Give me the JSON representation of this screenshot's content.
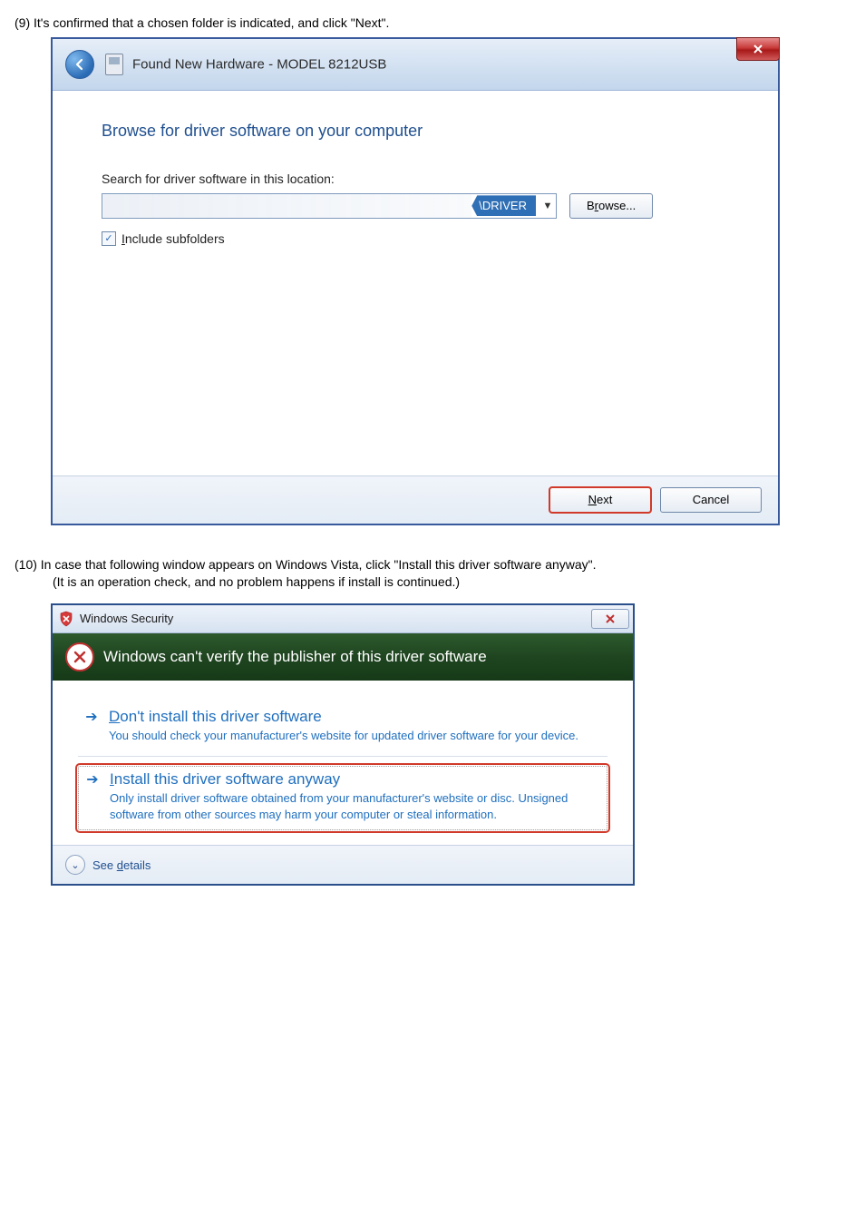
{
  "step9": {
    "text": "(9)  It's confirmed that a chosen folder is indicated, and click \"Next\"."
  },
  "win1": {
    "title": "Found New Hardware - MODEL 8212USB",
    "heading": "Browse for driver software on your computer",
    "search_label": "Search for driver software in this location:",
    "path_tag": "\\DRIVER",
    "browse_label_pre": "B",
    "browse_label_u": "r",
    "browse_label_post": "owse...",
    "include_pre": "",
    "include_u": "I",
    "include_post": "nclude subfolders",
    "next_u": "N",
    "next_post": "ext",
    "cancel": "Cancel"
  },
  "step10": {
    "text": "(10)  In case that following window appears on Windows Vista, click \"Install this driver software anyway\".",
    "sub": "(It is an operation check, and no problem happens if install is continued.)"
  },
  "win2": {
    "title": "Windows Security",
    "banner": "Windows can't verify the publisher of this driver software",
    "opt1": {
      "title_u": "D",
      "title_post": "on't install this driver software",
      "desc": "You should check your manufacturer's website for updated driver software for your device."
    },
    "opt2": {
      "title_u": "I",
      "title_post": "nstall this driver software anyway",
      "desc": "Only install driver software obtained from your manufacturer's website or disc. Unsigned software from other sources may harm your computer or steal information."
    },
    "details_pre": "See ",
    "details_u": "d",
    "details_post": "etails"
  }
}
